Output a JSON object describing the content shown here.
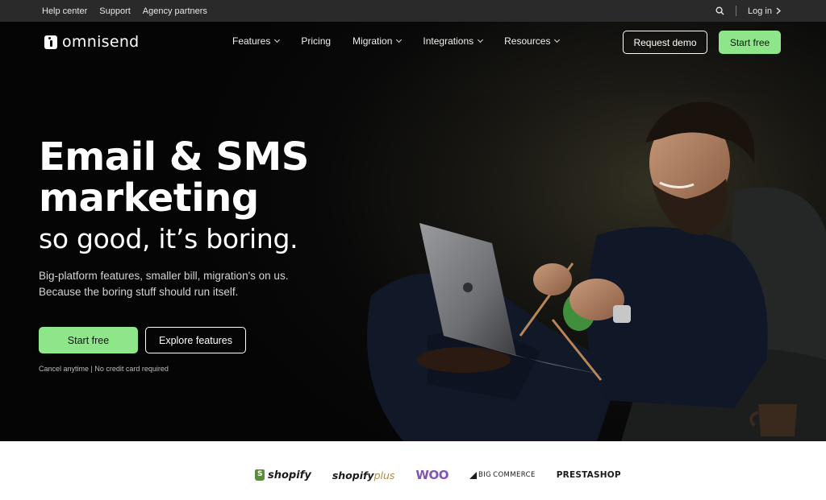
{
  "utility_bar": {
    "links": [
      "Help center",
      "Support",
      "Agency partners"
    ],
    "login_label": "Log in"
  },
  "nav": {
    "logo_text": "omnisend",
    "items": [
      {
        "label": "Features",
        "has_dropdown": true
      },
      {
        "label": "Pricing",
        "has_dropdown": false
      },
      {
        "label": "Migration",
        "has_dropdown": true
      },
      {
        "label": "Integrations",
        "has_dropdown": true
      },
      {
        "label": "Resources",
        "has_dropdown": true
      }
    ],
    "request_demo_label": "Request demo",
    "start_free_label": "Start free"
  },
  "hero": {
    "headline_line1": "Email & SMS",
    "headline_line2": "marketing",
    "subheadline": "so good, it’s boring.",
    "body_line1": "Big-platform features, smaller bill, migration's on us.",
    "body_line2": "Because the boring stuff should run itself.",
    "primary_cta": "Start free",
    "secondary_cta": "Explore features",
    "fine_print": "Cancel anytime | No credit card required"
  },
  "partners": {
    "shopify": "shopify",
    "shopify_plus_main": "shopify",
    "shopify_plus_suffix": "plus",
    "woo": "WOO",
    "bigcommerce_big": "BIG",
    "bigcommerce_rest": "COMMERCE",
    "prestashop": "PRESTASHOP"
  },
  "colors": {
    "accent_green": "#8fe68a",
    "hero_bg": "#050505",
    "woo_purple": "#7f54b3"
  }
}
